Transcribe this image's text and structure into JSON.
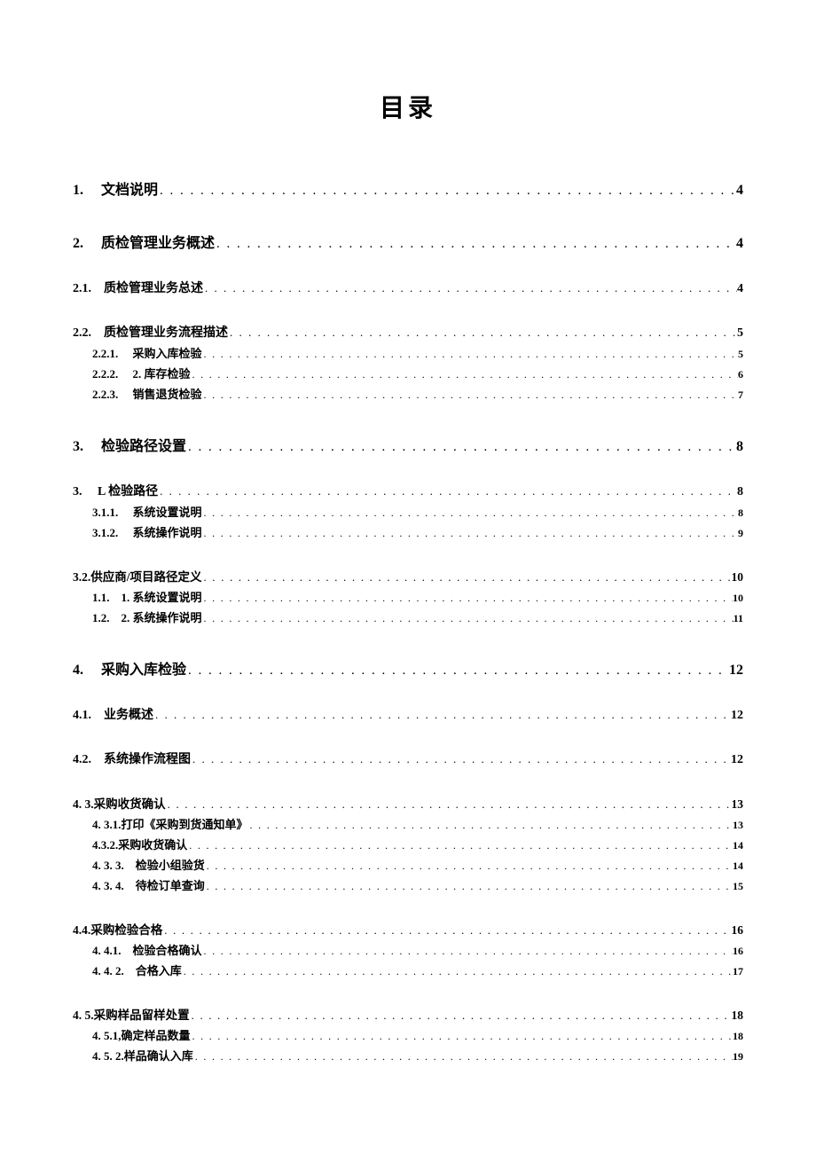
{
  "title": "目录",
  "dots": ". . . . . . . . . . . . . . . . . . . . . . . . . . . . . . . . . . . . . . . . . . . . . . . . . . . . . . . . . . . . . . . . . . . . . . . . . . . . . . . . . . . . . . . . . . . . . . . . . . . . . . . . . . . . . . . . . . . . . . . . . . . . . .",
  "entries": [
    {
      "lvl": "lvl1 lvl1-first",
      "num": "1.",
      "gap": "     ",
      "text": "文档说明 ",
      "page": "4"
    },
    {
      "lvl": "lvl1",
      "num": "2.",
      "gap": "     ",
      "text": "质检管理业务概述 ",
      "page": "4"
    },
    {
      "lvl": "lvl2",
      "num": "2.1.",
      "gap": "    ",
      "text": "质检管理业务总述 ",
      "page": "4"
    },
    {
      "lvl": "lvl2",
      "num": "2.2.",
      "gap": "    ",
      "text": "质检管理业务流程描述 ",
      "page": "5"
    },
    {
      "lvl": "lvl3",
      "num": "2.2.1.",
      "gap": "     ",
      "text": "采购入库检验 ",
      "page": "5"
    },
    {
      "lvl": "lvl3",
      "num": "2.2.2.",
      "gap": "     ",
      "text": "2. 库存检验 ",
      "page": "6"
    },
    {
      "lvl": "lvl3",
      "num": "2.2.3.",
      "gap": "     ",
      "text": "销售退货检验 ",
      "page": "7"
    },
    {
      "lvl": "lvl1",
      "num": "3.",
      "gap": "     ",
      "text": "检验路径设置 ",
      "page": "8"
    },
    {
      "lvl": "lvl2",
      "num": "3.",
      "gap": "     ",
      "text": "L 检验路径 ",
      "page": "8"
    },
    {
      "lvl": "lvl3",
      "num": "3.1.1.",
      "gap": "     ",
      "text": "系统设置说明 ",
      "page": "8"
    },
    {
      "lvl": "lvl3",
      "num": "3.1.2.",
      "gap": "     ",
      "text": "系统操作说明 ",
      "page": "9"
    },
    {
      "lvl": "lvl2nopad",
      "num": "3.2.",
      "gap": "",
      "text": "供应商/项目路径定义 ",
      "page": "10"
    },
    {
      "lvl": "lvl3",
      "num": "1.1.",
      "gap": "    ",
      "text": "1. 系统设置说明 ",
      "page": "10"
    },
    {
      "lvl": "lvl3",
      "num": "1.2.",
      "gap": "    ",
      "text": "2. 系统操作说明 ",
      "page": " 11"
    },
    {
      "lvl": "lvl1",
      "num": "4.",
      "gap": "     ",
      "text": "采购入库检验 ",
      "page": "12"
    },
    {
      "lvl": "lvl2",
      "num": "4.1.",
      "gap": "    ",
      "text": "业务概述 ",
      "page": "12"
    },
    {
      "lvl": "lvl2",
      "num": "4.2.",
      "gap": "    ",
      "text": "系统操作流程图 ",
      "page": "12"
    },
    {
      "lvl": "lvl2nopad",
      "num": "4. 3.",
      "gap": "",
      "text": "采购收货确认 ",
      "page": "13"
    },
    {
      "lvl": "lvl3",
      "num": "4. 3.1. ",
      "gap": "",
      "text": "打印《采购到货通知单》 ",
      "page": " 13"
    },
    {
      "lvl": "lvl3",
      "num": "4.3.2.",
      "gap": "",
      "text": "采购收货确认 ",
      "page": " 14"
    },
    {
      "lvl": "lvl3",
      "num": "4. 3. 3.",
      "gap": "    ",
      "text": "检验小组验货 ",
      "page": " 14"
    },
    {
      "lvl": "lvl3",
      "num": "4. 3. 4.",
      "gap": "    ",
      "text": "待检订单查询 ",
      "page": " 15"
    },
    {
      "lvl": "lvl2nopad",
      "num": "4.4.",
      "gap": "",
      "text": "采购检验合格 ",
      "page": "16"
    },
    {
      "lvl": "lvl3",
      "num": "4. 4.1.",
      "gap": "    ",
      "text": "检验合格确认 ",
      "page": " 16"
    },
    {
      "lvl": "lvl3",
      "num": "4. 4. 2.",
      "gap": "    ",
      "text": "合格入库 ",
      "page": " 17"
    },
    {
      "lvl": "lvl2nopad",
      "num": "4. 5.",
      "gap": "",
      "text": "采购样品留样处置 ",
      "page": "18"
    },
    {
      "lvl": "lvl3",
      "num": "4. 5.1,",
      "gap": "",
      "text": "确定样品数量 ",
      "page": " 18"
    },
    {
      "lvl": "lvl3",
      "num": "4. 5. 2. ",
      "gap": "",
      "text": "样品确认入库 ",
      "page": " 19"
    }
  ]
}
